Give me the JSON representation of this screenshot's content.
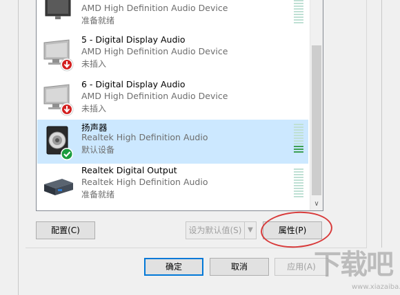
{
  "devices": [
    {
      "name": "",
      "description": "AMD High Definition Audio Device",
      "status": "准备就绪",
      "icon": "monitor-icon",
      "badge": "",
      "meter_level": 0
    },
    {
      "name": "5 - Digital Display Audio",
      "description": "AMD High Definition Audio Device",
      "status": "未插入",
      "icon": "monitor-icon",
      "badge": "unplugged-badge-icon",
      "meter_level": 0
    },
    {
      "name": "6 - Digital Display Audio",
      "description": "AMD High Definition Audio Device",
      "status": "未插入",
      "icon": "monitor-icon",
      "badge": "unplugged-badge-icon",
      "meter_level": 0
    },
    {
      "name": "扬声器",
      "description": "Realtek High Definition Audio",
      "status": "默认设备",
      "icon": "speaker-icon",
      "badge": "default-check-badge-icon",
      "meter_level": 0.27,
      "selected": true
    },
    {
      "name": "Realtek Digital Output",
      "description": "Realtek High Definition Audio",
      "status": "准备就绪",
      "icon": "digital-output-icon",
      "badge": "",
      "meter_level": 0
    }
  ],
  "buttons": {
    "configure": "配置(C)",
    "set_default": "设为默认值(S)",
    "properties": "属性(P)",
    "ok": "确定",
    "cancel": "取消",
    "apply": "应用(A)"
  },
  "watermark": {
    "text": "下载吧",
    "url": "www.xiazaiba.com"
  },
  "colors": {
    "selection": "#cce8ff",
    "accent": "#0078d7",
    "ring": "#d83a3a",
    "meter_on": "#3c9f52"
  }
}
